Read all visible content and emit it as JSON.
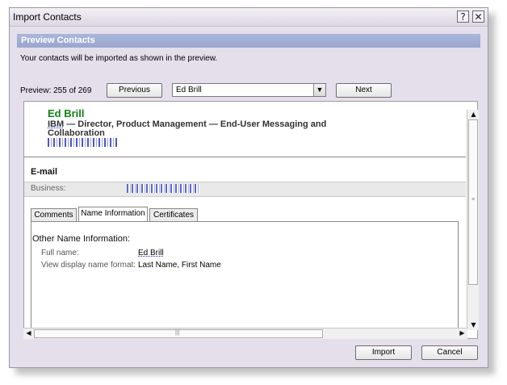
{
  "window": {
    "title": "Import Contacts",
    "help_glyph": "?",
    "close_glyph": "✕"
  },
  "header": {
    "section_title": "Preview Contacts",
    "description": "Your contacts will be imported as shown in the preview."
  },
  "navigation": {
    "counter": "Preview: 255 of 269",
    "previous_label": "Previous",
    "next_label": "Next",
    "selected_contact": "Ed Brill"
  },
  "contact": {
    "name": "Ed Brill",
    "company": "IBM",
    "title_line": "  —  Director, Product Management — End-User Messaging and Collaboration",
    "email_section_title": "E-mail",
    "business_label": "Business:"
  },
  "tabs": [
    {
      "label": "Comments",
      "active": false
    },
    {
      "label": "Name Information",
      "active": true
    },
    {
      "label": "Certificates",
      "active": false
    }
  ],
  "name_info": {
    "heading": "Other Name Information:",
    "full_name_label": "Full name:",
    "full_name_value": "Ed Brill",
    "display_label": "View display  name format:",
    "display_value": "Last Name, First Name"
  },
  "footer": {
    "import_label": "Import",
    "cancel_label": "Cancel"
  }
}
